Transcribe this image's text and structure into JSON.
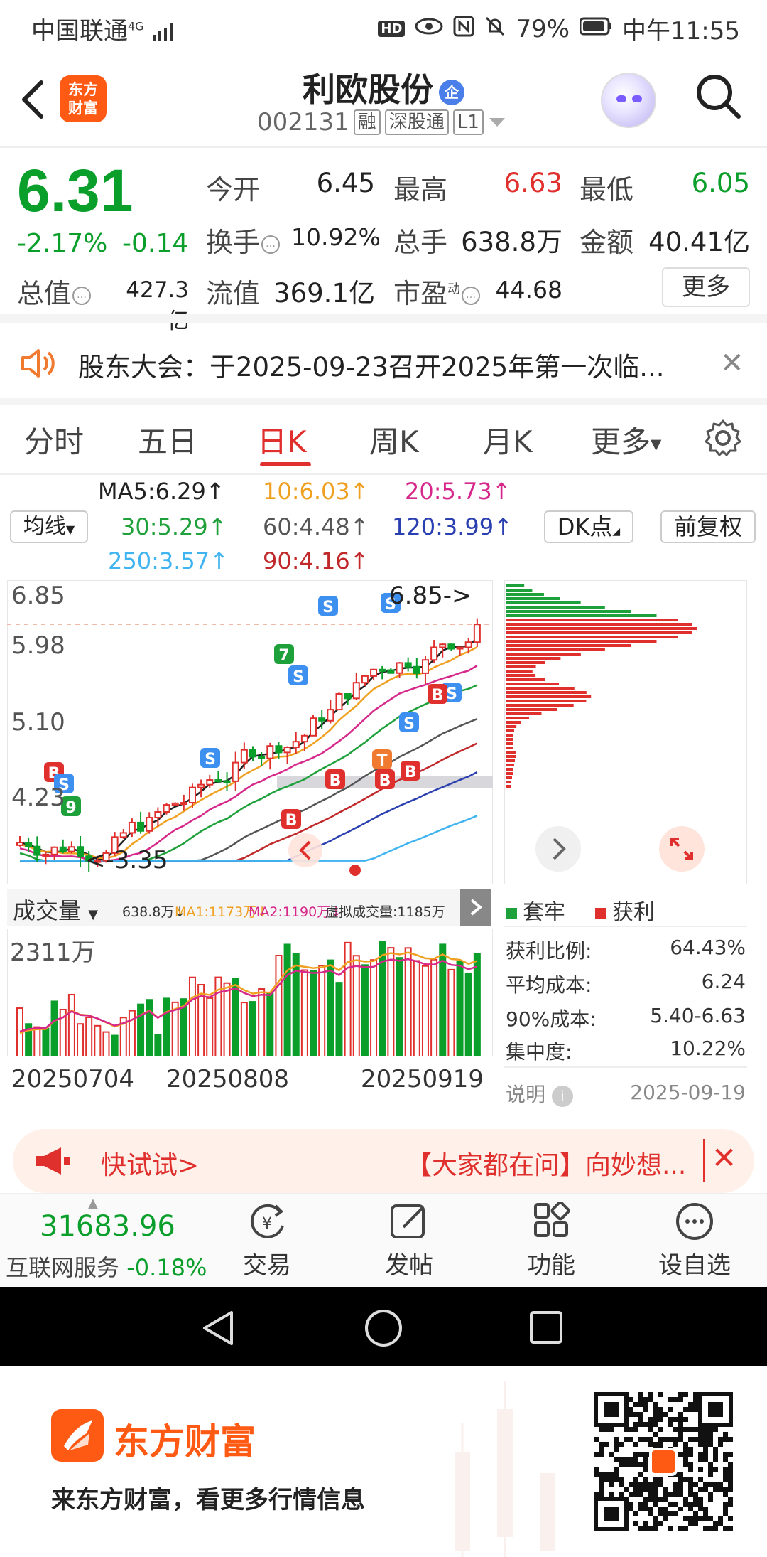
{
  "status_bar": {
    "carrier": "中国联通",
    "network": "4G",
    "battery": "79%",
    "time": "中午11:55",
    "icons": [
      "hd-icon",
      "eye-icon",
      "nfc-icon",
      "mute-bell-icon",
      "battery-icon"
    ]
  },
  "header": {
    "brand_logo": "东方财富",
    "stock_name": "利欧股份",
    "badge": "企",
    "stock_code": "002131",
    "tags": [
      "融",
      "深股通",
      "L1"
    ]
  },
  "quote": {
    "price": "6.31",
    "change_pct": "-2.17%",
    "change_abs": "-0.14",
    "open_label": "今开",
    "open": "6.45",
    "high_label": "最高",
    "high": "6.63",
    "low_label": "最低",
    "low": "6.05",
    "turnover_label": "换手",
    "turnover": "10.92%",
    "volume_label": "总手",
    "volume": "638.8万",
    "amount_label": "金额",
    "amount": "40.41亿",
    "total_value_label": "总值",
    "total_value": "427.3亿",
    "float_value_label": "流值",
    "float_value": "369.1亿",
    "pe_label": "市盈",
    "pe_sup": "动",
    "pe": "44.68",
    "more_button": "更多"
  },
  "notice": {
    "text": "股东大会：于2025-09-23召开2025年第一次临..."
  },
  "tabs": {
    "items": [
      "分时",
      "五日",
      "日K",
      "周K",
      "月K",
      "更多"
    ],
    "active": "日K"
  },
  "ma_legend": {
    "ma5": "MA5:6.29↑",
    "ma10": "10:6.03↑",
    "ma20": "20:5.73↑",
    "ma30": "30:5.29↑",
    "ma60": "60:4.48↑",
    "ma120": "120:3.99↑",
    "ma250": "250:3.57↑",
    "ma90": "90:4.16↑",
    "junxian": "均线",
    "dk": "DK点",
    "fuquan": "前复权",
    "colors": {
      "ma5": "#222222",
      "ma10": "#f0a020",
      "ma20": "#d6288a",
      "ma30": "#1ea03a",
      "ma60": "#555555",
      "ma120": "#2a3fb0",
      "ma250": "#3fb4f0",
      "ma90": "#c0282a"
    }
  },
  "kline": {
    "axis_labels": [
      "6.85",
      "5.98",
      "5.10",
      "4.23",
      "3.35"
    ],
    "high_marker": "6.85->",
    "low_marker": "<-3.35"
  },
  "volume": {
    "selector": "成交量",
    "vol": "638.8万↓",
    "ma1": "MA1:1173万↓",
    "ma2": "MA2:1190万↓",
    "virtual": "虚拟成交量:1185万",
    "max_label": "2311万",
    "dates": [
      "20250704",
      "20250808",
      "20250919"
    ]
  },
  "chips": {
    "legend_trapped": "套牢",
    "legend_profit": "获利",
    "rows": [
      {
        "label": "获利比例:",
        "value": "64.43%"
      },
      {
        "label": "平均成本:",
        "value": "6.24"
      },
      {
        "label": "90%成本:",
        "value": "5.40-6.63"
      },
      {
        "label": "集中度:",
        "value": "10.22%"
      }
    ],
    "note_label": "说明",
    "date": "2025-09-19"
  },
  "ad": {
    "left": "快试试>",
    "right": "【大家都在问】向妙想..."
  },
  "bottom_bar": {
    "index_value": "31683.96",
    "index_name": "互联网服务",
    "index_change": "-0.18%",
    "items": [
      "交易",
      "发帖",
      "功能",
      "设自选"
    ]
  },
  "promo": {
    "brand": "东方财富",
    "slogan": "来东方财富，看更多行情信息"
  }
}
